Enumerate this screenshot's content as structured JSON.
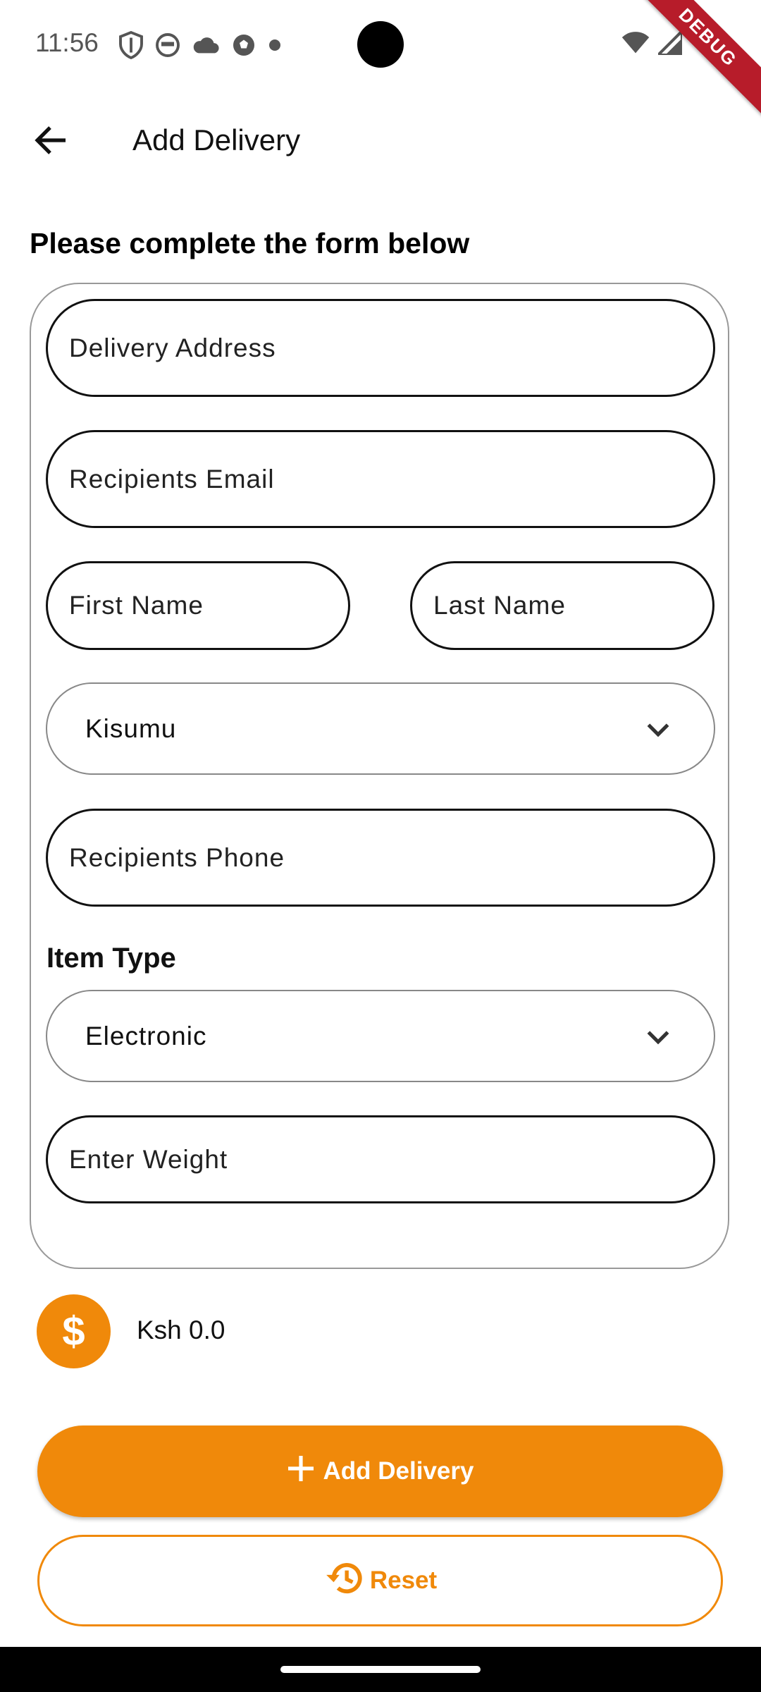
{
  "status_bar": {
    "time": "11:56",
    "debug_label": "DEBUG"
  },
  "app_bar": {
    "title": "Add Delivery",
    "back_icon": "arrow-left-icon"
  },
  "form": {
    "heading": "Please complete the form below",
    "delivery_address": {
      "placeholder": "Delivery Address",
      "value": ""
    },
    "recipients_email": {
      "placeholder": "Recipients Email",
      "value": ""
    },
    "first_name": {
      "placeholder": "First Name",
      "value": ""
    },
    "last_name": {
      "placeholder": "Last Name",
      "value": ""
    },
    "city_select": {
      "selected": "Kisumu"
    },
    "recipients_phone": {
      "placeholder": "Recipients Phone",
      "value": ""
    },
    "item_type_label": "Item Type",
    "item_type_select": {
      "selected": "Electronic"
    },
    "weight": {
      "placeholder": "Enter Weight",
      "value": ""
    }
  },
  "price": {
    "currency_symbol": "$",
    "amount_text": "Ksh 0.0"
  },
  "actions": {
    "add_label": "Add Delivery",
    "reset_label": "Reset"
  },
  "colors": {
    "accent": "#f0890a",
    "debug_ribbon": "#b71c2a"
  }
}
